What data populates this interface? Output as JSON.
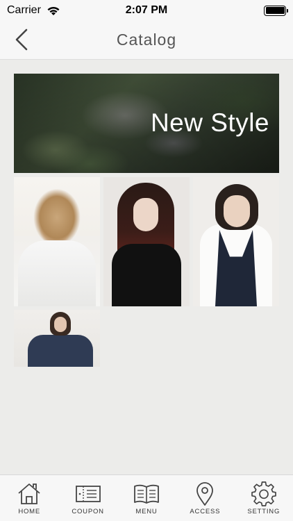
{
  "status_bar": {
    "carrier": "Carrier",
    "time": "2:07 PM",
    "battery_level": 1.0
  },
  "nav": {
    "title": "Catalog",
    "back_icon": "chevron-left-icon"
  },
  "banner": {
    "title": "New Style"
  },
  "catalog_items": [
    {
      "icon": "photo"
    },
    {
      "icon": "photo"
    },
    {
      "icon": "photo"
    },
    {
      "icon": "photo"
    }
  ],
  "tab_bar": {
    "tabs": [
      {
        "label": "HOME",
        "icon": "home-icon"
      },
      {
        "label": "COUPON",
        "icon": "coupon-icon"
      },
      {
        "label": "MENU",
        "icon": "menu-book-icon"
      },
      {
        "label": "ACCESS",
        "icon": "map-pin-icon"
      },
      {
        "label": "SETTING",
        "icon": "gear-icon"
      }
    ]
  }
}
